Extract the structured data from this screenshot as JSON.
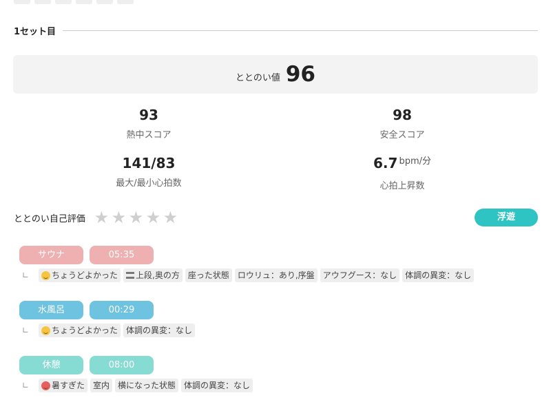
{
  "top_tags": [
    "…",
    "…",
    "…",
    "…",
    "…",
    "…"
  ],
  "set": {
    "title": "1セット目"
  },
  "totonoi": {
    "label": "ととのい値",
    "value": "96"
  },
  "stats": [
    {
      "value": "93",
      "unit": "",
      "label": "熱中スコア"
    },
    {
      "value": "98",
      "unit": "",
      "label": "安全スコア"
    },
    {
      "value": "141/83",
      "unit": "",
      "label": "最大/最小心拍数"
    },
    {
      "value": "6.7",
      "unit": "bpm/分",
      "label": "心拍上昇数"
    }
  ],
  "self_eval": {
    "label": "ととのい自己評価",
    "rating": 0,
    "max": 5,
    "button": "浮遊"
  },
  "phases": [
    {
      "name": "サウナ",
      "time": "05:35",
      "color": "#eeb0b0",
      "notes": [
        "ちょうどよかった",
        "上段,奥の方",
        "座った状態",
        "ロウリュ：あり,序盤",
        "アウフグース：なし",
        "体調の異変：なし"
      ]
    },
    {
      "name": "水風呂",
      "time": "00:29",
      "color": "#6ec3e0",
      "notes": [
        "ちょうどよかった",
        "体調の異変：なし"
      ]
    },
    {
      "name": "休憩",
      "time": "08:00",
      "color": "#86dbd3",
      "notes": [
        "暑すぎた",
        "室内",
        "横になった状態",
        "体調の異変：なし"
      ]
    }
  ],
  "icons": {
    "star": "star-icon",
    "good": "smile-emoji-icon",
    "hot": "hot-face-emoji-icon",
    "tier": "tier-icon",
    "branch": "branch-icon"
  }
}
